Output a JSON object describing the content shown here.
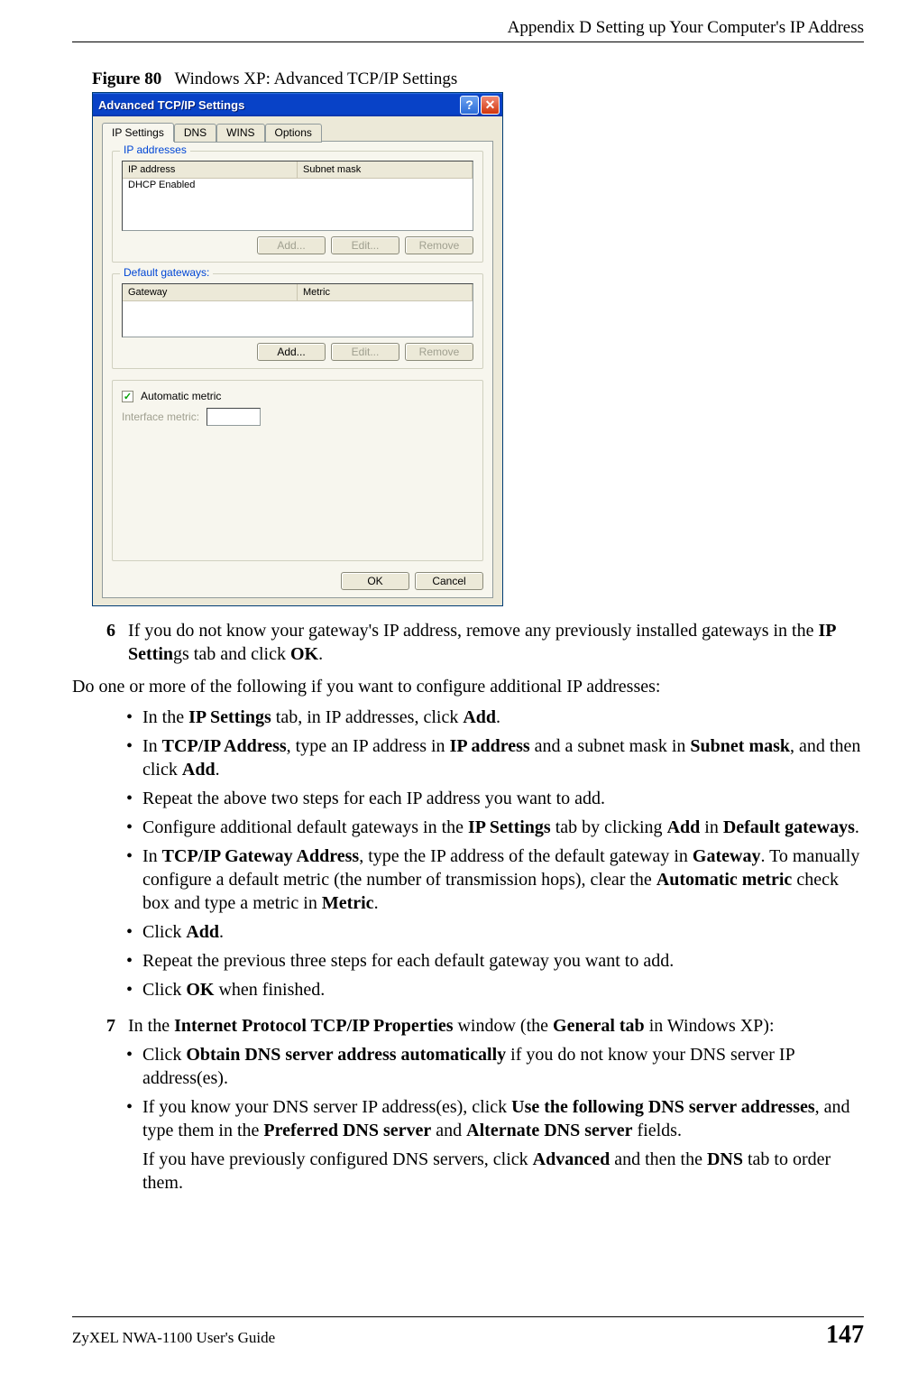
{
  "header": {
    "appendix_title": "Appendix D Setting up Your Computer's IP Address"
  },
  "figure": {
    "label": "Figure 80",
    "caption": "Windows XP: Advanced TCP/IP Settings"
  },
  "dialog": {
    "title": "Advanced TCP/IP Settings",
    "help_btn": "?",
    "close_btn": "✕",
    "tabs": [
      "IP Settings",
      "DNS",
      "WINS",
      "Options"
    ],
    "group_ip": {
      "title": "IP addresses",
      "headers": [
        "IP address",
        "Subnet mask"
      ],
      "row1": "DHCP Enabled",
      "btn_add": "Add...",
      "btn_edit": "Edit...",
      "btn_remove": "Remove"
    },
    "group_gw": {
      "title": "Default gateways:",
      "headers": [
        "Gateway",
        "Metric"
      ],
      "btn_add": "Add...",
      "btn_edit": "Edit...",
      "btn_remove": "Remove"
    },
    "auto_metric_label": "Automatic metric",
    "interface_metric_label": "Interface metric:",
    "btn_ok": "OK",
    "btn_cancel": "Cancel"
  },
  "step6": {
    "num": "6",
    "text_pre": "If you do not know your gateway's IP address, remove any previously installed gateways in the ",
    "bold1": "IP Settin",
    "text_mid": "gs tab and click ",
    "bold2": "OK",
    "text_post": "."
  },
  "para1": "Do one or more of the following if you want to configure additional IP addresses:",
  "bullets1": {
    "b1_pre": "In the ",
    "b1_b1": "IP Settings",
    "b1_mid": " tab, in IP addresses, click ",
    "b1_b2": "Add",
    "b1_post": ".",
    "b2_pre": "In ",
    "b2_b1": "TCP/IP Address",
    "b2_mid1": ", type an IP address in ",
    "b2_b2": "IP address",
    "b2_mid2": " and a subnet mask in ",
    "b2_b3": "Subnet mask",
    "b2_mid3": ", and then click ",
    "b2_b4": "Add",
    "b2_post": ".",
    "b3": "Repeat the above two steps for each IP address you want to add.",
    "b4_pre": "Configure additional default gateways in the ",
    "b4_b1": "IP Settings",
    "b4_mid": " tab by clicking ",
    "b4_b2": "Add",
    "b4_mid2": " in ",
    "b4_b3": "Default gateways",
    "b4_post": ".",
    "b5_pre": "In ",
    "b5_b1": "TCP/IP Gateway Address",
    "b5_mid1": ", type the IP address of the default gateway in ",
    "b5_b2": "Gateway",
    "b5_mid2": ". To manually configure a default metric (the number of transmission hops), clear the ",
    "b5_b3": "Automatic metric",
    "b5_mid3": " check box and type a metric in ",
    "b5_b4": "Metric",
    "b5_post": ".",
    "b6_pre": "Click ",
    "b6_b1": "Add",
    "b6_post": ".",
    "b7": "Repeat the previous three steps for each default gateway you want to add.",
    "b8_pre": "Click ",
    "b8_b1": "OK",
    "b8_post": " when finished."
  },
  "step7": {
    "num": "7",
    "text_pre": "In the ",
    "b1": "Internet Protocol TCP/IP Properties",
    "text_mid1": " window (the ",
    "b2": "General tab",
    "text_mid2": " in Windows XP):"
  },
  "bullets2": {
    "b1_pre": "Click ",
    "b1_b1": "Obtain DNS server address automatically",
    "b1_post": " if you do not know your DNS server IP address(es).",
    "b2_pre": "If you know your DNS server IP address(es), click ",
    "b2_b1": "Use the following DNS server addresses",
    "b2_mid1": ", and type them in the ",
    "b2_b2": "Preferred DNS server",
    "b2_mid2": " and ",
    "b2_b3": "Alternate DNS server",
    "b2_post": " fields.",
    "sub_pre": "If you have previously configured DNS servers, click ",
    "sub_b1": "Advanced",
    "sub_mid": " and then the ",
    "sub_b2": "DNS",
    "sub_post": " tab to order them."
  },
  "footer": {
    "guide": "ZyXEL NWA-1100 User's Guide",
    "page": "147"
  }
}
